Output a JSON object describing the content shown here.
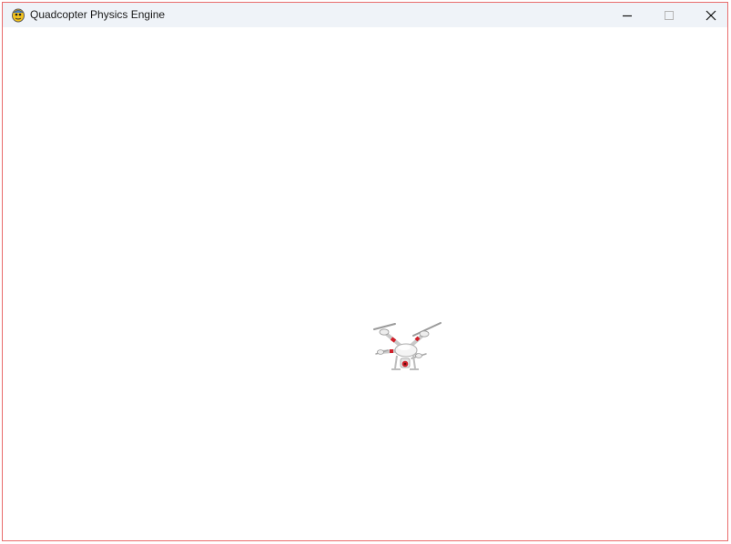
{
  "window": {
    "title": "Quadcopter Physics Engine",
    "app_icon": "pygame-snake-icon",
    "controls": {
      "minimize_icon": "minimize-icon",
      "maximize_icon": "maximize-icon",
      "close_icon": "close-icon"
    },
    "border_color": "#e96b6b",
    "titlebar_color": "#eff3f8"
  },
  "scene": {
    "background_color": "#ffffff",
    "object": "quadcopter-drone",
    "accent_color": "#d0202a"
  }
}
